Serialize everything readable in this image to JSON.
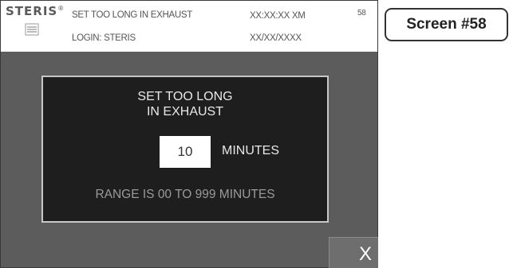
{
  "header": {
    "brand": "STERIS",
    "brand_mark": "®",
    "title": "SET TOO LONG IN EXHAUST",
    "login": "LOGIN: STERIS",
    "time": "XX:XX:XX XM",
    "date": "XX/XX/XXXX",
    "screen_number": "58"
  },
  "dialog": {
    "title_line1": "SET TOO LONG",
    "title_line2": "IN EXHAUST",
    "value": "10",
    "unit": "MINUTES",
    "range": "RANGE IS 00 TO 999 MINUTES"
  },
  "close_button": {
    "label": "X"
  },
  "screen_label": "Screen #58",
  "icons": {
    "brand_logo": "steris-logo-icon"
  },
  "colors": {
    "screen_bg": "#5c5c5c",
    "dialog_bg": "#1e1e1e",
    "dialog_border": "#c8c8c8",
    "close_bg": "#6e6e6e"
  }
}
